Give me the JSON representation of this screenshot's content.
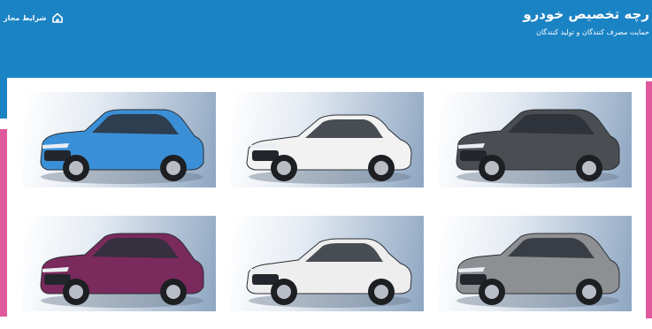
{
  "header": {
    "title": "رچه تخصیص خودرو",
    "subtitle": "حمایت مصرف کنندگان و تولید کنندگان",
    "nav_label": "شرایط مجاز",
    "background": "#1a83c4",
    "accent": "#e0599c"
  },
  "cars": [
    {
      "id": "car-blue-suv",
      "color": "#3b8fd6",
      "shape": "suv"
    },
    {
      "id": "car-white-sedan",
      "color": "#f2f2f2",
      "shape": "sedan"
    },
    {
      "id": "car-dark-crossover",
      "color": "#4a4d52",
      "shape": "suv"
    },
    {
      "id": "car-purple-suv",
      "color": "#7a2a5c",
      "shape": "suv"
    },
    {
      "id": "car-white-sedan-2",
      "color": "#eeeeee",
      "shape": "sedan"
    },
    {
      "id": "car-gray-suv",
      "color": "#8d8f92",
      "shape": "suv"
    }
  ]
}
